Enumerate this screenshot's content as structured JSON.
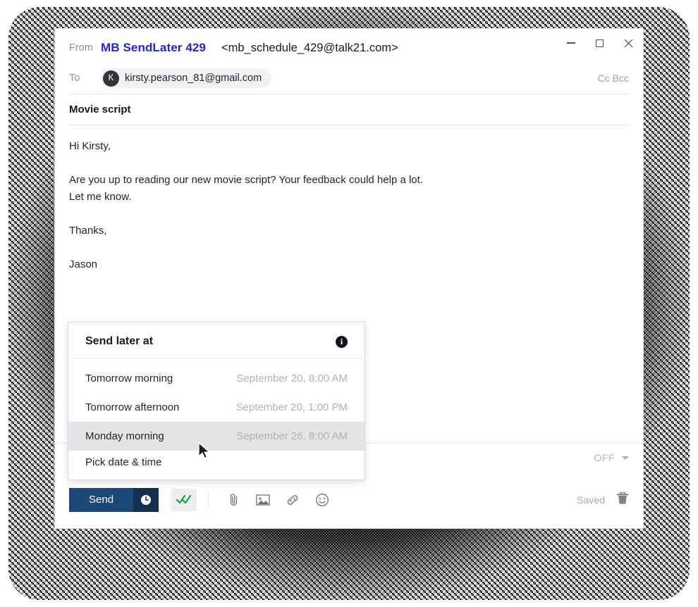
{
  "window": {
    "controls": [
      {
        "name": "minimize",
        "label": "–"
      },
      {
        "name": "maximize",
        "label": "□"
      },
      {
        "name": "close",
        "label": "✕"
      }
    ]
  },
  "header": {
    "from_label": "From",
    "from_name": "MB SendLater 429",
    "from_address": "<mb_schedule_429@talk21.com>",
    "to_label": "To",
    "recipient_initial": "K",
    "recipient_email": "kirsty.pearson_81@gmail.com",
    "cc_bcc_label": "Cc Bcc"
  },
  "subject": "Movie script",
  "body": {
    "greeting": "Hi Kirsty,",
    "paragraph_line1": "Are you up to reading our new movie script? Your feedback could help a lot.",
    "paragraph_line2": "Let me know.",
    "closing": "Thanks,",
    "signature": "Jason"
  },
  "format_toolbar": {
    "buttons": [
      {
        "name": "align",
        "icon": "align-left-icon"
      },
      {
        "name": "numbered-list",
        "icon": "numbered-list-icon"
      },
      {
        "name": "bulleted-list",
        "icon": "bulleted-list-icon"
      },
      {
        "name": "decrease-indent",
        "icon": "decrease-indent-icon"
      },
      {
        "name": "increase-indent",
        "icon": "increase-indent-icon"
      }
    ],
    "off_label": "OFF"
  },
  "dropdown": {
    "title": "Send later at",
    "info_glyph": "i",
    "options": [
      {
        "label": "Tomorrow morning",
        "when": "September 20, 8:00 AM",
        "highlighted": false
      },
      {
        "label": "Tomorrow afternoon",
        "when": "September 20, 1:00 PM",
        "highlighted": false
      },
      {
        "label": "Monday morning",
        "when": "September 26, 8:00 AM",
        "highlighted": true
      },
      {
        "label": "Pick date & time",
        "when": "",
        "highlighted": false
      }
    ]
  },
  "bottom_bar": {
    "send_label": "Send",
    "schedule_icon": "clock-icon",
    "read_receipt_icon": "double-check-icon",
    "icons": [
      {
        "name": "attach",
        "icon": "paperclip-icon"
      },
      {
        "name": "insert-image",
        "icon": "image-icon"
      },
      {
        "name": "insert-link",
        "icon": "link-icon"
      },
      {
        "name": "insert-emoji",
        "icon": "emoji-icon"
      }
    ],
    "saved_label": "Saved",
    "discard_icon": "trash-icon"
  },
  "colors": {
    "send_button": "#1c4776",
    "send_clock": "#122f4e",
    "from_name": "#2323d8",
    "highlight_row": "#e3e4e6",
    "check_green": "#1e9e3e"
  }
}
